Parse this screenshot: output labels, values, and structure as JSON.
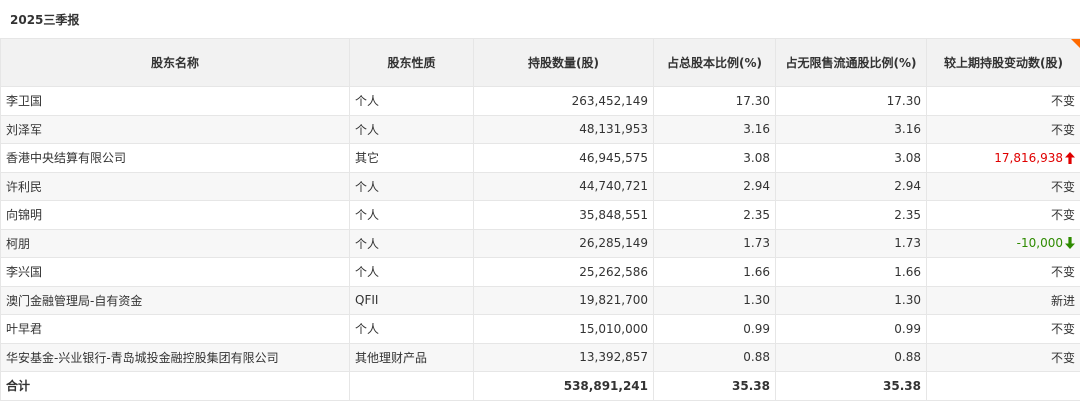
{
  "report_title": "2025三季报",
  "headers": [
    "股东名称",
    "股东性质",
    "持股数量(股)",
    "占总股本比例(%)",
    "占无限售流通股比例(%)",
    "较上期持股变动数(股)"
  ],
  "rows": [
    {
      "name": "李卫国",
      "type": "个人",
      "shares": "263,452,149",
      "pct_total": "17.30",
      "pct_float": "17.30",
      "change": "不变",
      "trend": "none"
    },
    {
      "name": "刘泽军",
      "type": "个人",
      "shares": "48,131,953",
      "pct_total": "3.16",
      "pct_float": "3.16",
      "change": "不变",
      "trend": "none"
    },
    {
      "name": "香港中央结算有限公司",
      "type": "其它",
      "shares": "46,945,575",
      "pct_total": "3.08",
      "pct_float": "3.08",
      "change": "17,816,938",
      "trend": "up"
    },
    {
      "name": "许利民",
      "type": "个人",
      "shares": "44,740,721",
      "pct_total": "2.94",
      "pct_float": "2.94",
      "change": "不变",
      "trend": "none"
    },
    {
      "name": "向锦明",
      "type": "个人",
      "shares": "35,848,551",
      "pct_total": "2.35",
      "pct_float": "2.35",
      "change": "不变",
      "trend": "none"
    },
    {
      "name": "柯朋",
      "type": "个人",
      "shares": "26,285,149",
      "pct_total": "1.73",
      "pct_float": "1.73",
      "change": "-10,000",
      "trend": "down"
    },
    {
      "name": "李兴国",
      "type": "个人",
      "shares": "25,262,586",
      "pct_total": "1.66",
      "pct_float": "1.66",
      "change": "不变",
      "trend": "none"
    },
    {
      "name": "澳门金融管理局-自有资金",
      "type": "QFII",
      "shares": "19,821,700",
      "pct_total": "1.30",
      "pct_float": "1.30",
      "change": "新进",
      "trend": "none"
    },
    {
      "name": "叶早君",
      "type": "个人",
      "shares": "15,010,000",
      "pct_total": "0.99",
      "pct_float": "0.99",
      "change": "不变",
      "trend": "none"
    },
    {
      "name": "华安基金-兴业银行-青岛城投金融控股集团有限公司",
      "type": "其他理财产品",
      "shares": "13,392,857",
      "pct_total": "0.88",
      "pct_float": "0.88",
      "change": "不变",
      "trend": "none"
    }
  ],
  "total": {
    "label": "合计",
    "shares": "538,891,241",
    "pct_total": "35.38",
    "pct_float": "35.38"
  },
  "colors": {
    "header_bg": "#f2f2f2",
    "alt_row_bg": "#f7f7f7",
    "border": "#e6e6e6",
    "up": "#e00000",
    "down": "#2e8b00",
    "corner_accent": "#ff6a00"
  }
}
